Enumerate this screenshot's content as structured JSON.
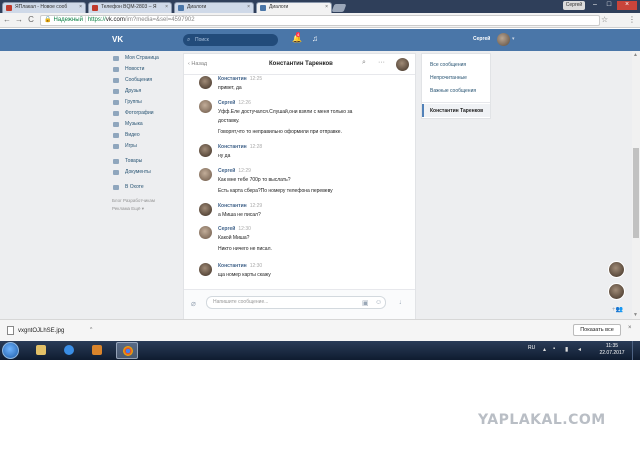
{
  "browser": {
    "tabs": [
      {
        "label": "ЯПлакал - Новое сооб",
        "fav_color": "#c0392b",
        "active": false
      },
      {
        "label": "Телефон BQM-2803 – Я",
        "fav_color": "#c0392b",
        "active": false
      },
      {
        "label": "Диалоги",
        "fav_color": "#4a76a8",
        "active": false
      },
      {
        "label": "Диалоги",
        "fav_color": "#4a76a8",
        "active": true
      }
    ],
    "tab_close": "×",
    "user_label": "Сергей",
    "window_minimize": "–",
    "window_maximize": "□",
    "window_close": "×",
    "back": "←",
    "forward": "→",
    "reload": "C",
    "secure_label": "Надежный",
    "url_proto": "https://",
    "url_host": "vk.com",
    "url_path": "/im?media=&sel=4597902",
    "star": "☆",
    "menu": "⋮"
  },
  "vk": {
    "logo": "VK",
    "search_placeholder": "Поиск",
    "notifications_count": "4",
    "user_name": "Сергей",
    "accent_color": "#4a76a8"
  },
  "left_menu": {
    "items": [
      {
        "label": "Моя Страница"
      },
      {
        "label": "Новости"
      },
      {
        "label": "Сообщения"
      },
      {
        "label": "Друзья"
      },
      {
        "label": "Группы"
      },
      {
        "label": "Фотографии"
      },
      {
        "label": "Музыка"
      },
      {
        "label": "Видео"
      },
      {
        "label": "Игры"
      }
    ],
    "items2": [
      {
        "label": "Товары"
      },
      {
        "label": "Документы"
      }
    ],
    "items3": [
      {
        "label": "В Охоте"
      }
    ],
    "footer_line1": "Блог  Разработчикам",
    "footer_line2": "Реклама  Ещё ▾"
  },
  "dialog": {
    "back_label": "‹  Назад",
    "title": "Константин Таренков",
    "compose_placeholder": "Напишите сообщение...",
    "messages": [
      {
        "author": "Константин",
        "time": "12:25",
        "lines": [
          "привет, да"
        ],
        "me": false
      },
      {
        "author": "Сергей",
        "time": "12:26",
        "lines": [
          "Уфф.Еле достучался.Слушай,они взяли с меня только за",
          "доставку.",
          "",
          "Говорят,что то неправильно оформили при отправке."
        ],
        "me": true
      },
      {
        "author": "Константин",
        "time": "12:28",
        "lines": [
          "ну да"
        ],
        "me": false
      },
      {
        "author": "Сергей",
        "time": "12:29",
        "lines": [
          "Как мне тебе 700р то выслать?",
          "",
          "Есть карта сбера?По номеру телефона перевеву"
        ],
        "me": true
      },
      {
        "author": "Константин",
        "time": "12:29",
        "lines": [
          "а Миша не писал?"
        ],
        "me": false
      },
      {
        "author": "Сергей",
        "time": "12:30",
        "lines": [
          "Какой Миша?",
          "",
          "Никто ничего не писал."
        ],
        "me": true
      },
      {
        "author": "Константин",
        "time": "12:30",
        "lines": [
          "ща номер карты скажу"
        ],
        "me": false
      }
    ]
  },
  "filters": {
    "items": [
      {
        "label": "Все сообщения"
      },
      {
        "label": "Непрочитанные"
      },
      {
        "label": "Важные сообщения"
      }
    ],
    "active_label": "Константин Таренков"
  },
  "float_add": "+👥",
  "downloads": {
    "file_name": "vxgntOJLhSE.jpg",
    "arrow": "^",
    "show_all": "Показать все",
    "close": "×"
  },
  "taskbar": {
    "lang": "RU",
    "time": "11:35",
    "date": "22.07.2017"
  },
  "watermark": "YAPLAKAL.COM"
}
